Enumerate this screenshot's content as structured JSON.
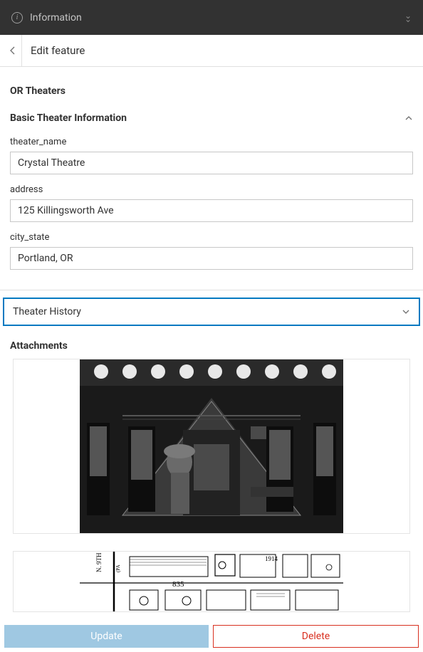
{
  "topBar": {
    "title": "Information"
  },
  "header": {
    "title": "Edit feature"
  },
  "layerName": "OR Theaters",
  "group": {
    "title": "Basic Theater Information",
    "fields": {
      "theater_name": {
        "label": "theater_name",
        "value": "Crystal Theatre"
      },
      "address": {
        "label": "address",
        "value": "125 Killingsworth Ave"
      },
      "city_state": {
        "label": "city_state",
        "value": "Portland, OR"
      }
    }
  },
  "collapsibleSection": {
    "title": "Theater History"
  },
  "attachments": {
    "label": "Attachments"
  },
  "footer": {
    "update": "Update",
    "delete": "Delete"
  }
}
